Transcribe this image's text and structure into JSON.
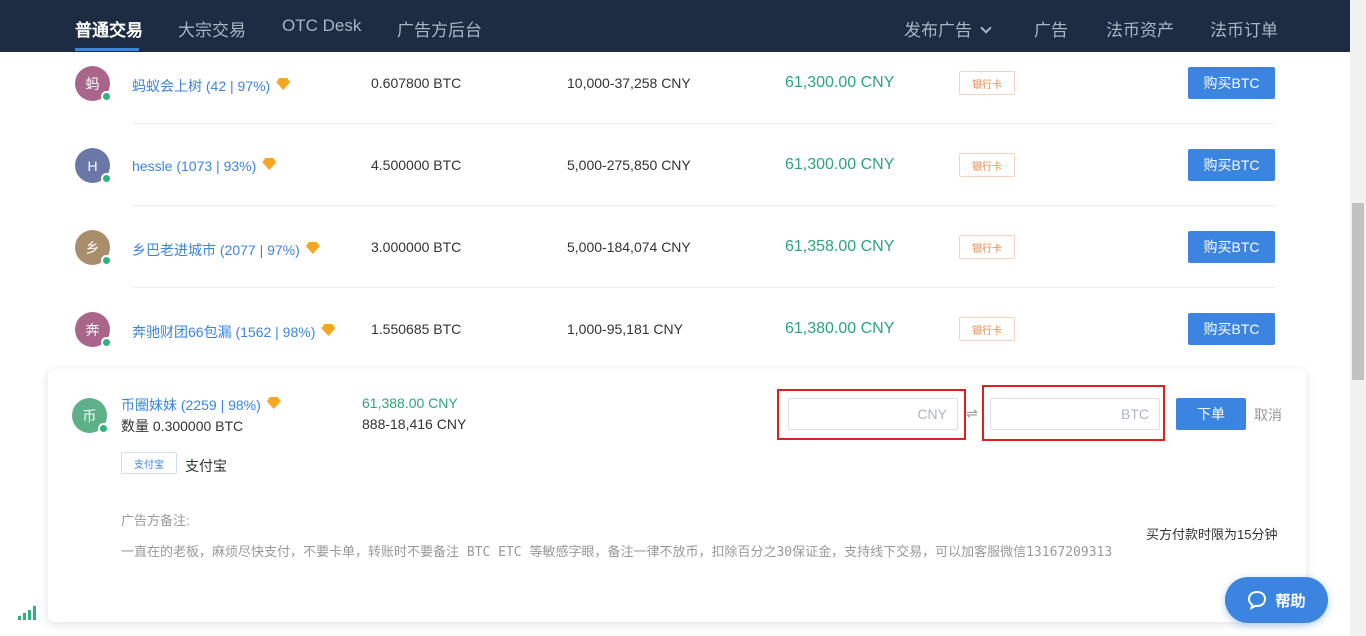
{
  "header": {
    "nav_left": [
      "普通交易",
      "大宗交易",
      "OTC Desk",
      "广告方后台"
    ],
    "publish_label": "发布广告",
    "nav_right": [
      "广告",
      "法币资产",
      "法币订单"
    ]
  },
  "listings": [
    {
      "avatar": "蚂",
      "avatar_color": "#a9668a",
      "seller": "蚂蚁会上树 (42 | 97%)",
      "amount": "0.607800 BTC",
      "limit": "10,000-37,258 CNY",
      "price": "61,300.00 CNY",
      "payment": "银行卡",
      "buy_label": "购买BTC"
    },
    {
      "avatar": "H",
      "avatar_color": "#6a78a8",
      "seller": "hessle (1073 | 93%)",
      "amount": "4.500000 BTC",
      "limit": "5,000-275,850 CNY",
      "price": "61,300.00 CNY",
      "payment": "银行卡",
      "buy_label": "购买BTC"
    },
    {
      "avatar": "乡",
      "avatar_color": "#a88e6a",
      "seller": "乡巴老进城市 (2077 | 97%)",
      "amount": "3.000000 BTC",
      "limit": "5,000-184,074 CNY",
      "price": "61,358.00 CNY",
      "payment": "银行卡",
      "buy_label": "购买BTC"
    },
    {
      "avatar": "奔",
      "avatar_color": "#a9668a",
      "seller": "奔驰财团66包漏 (1562 | 98%)",
      "amount": "1.550685 BTC",
      "limit": "1,000-95,181 CNY",
      "price": "61,380.00 CNY",
      "payment": "银行卡",
      "buy_label": "购买BTC"
    }
  ],
  "expanded": {
    "avatar": "币",
    "seller": "币圈妹妹 (2259 | 98%)",
    "quantity": "数量 0.300000 BTC",
    "price": "61,388.00 CNY",
    "limit": "888-18,416 CNY",
    "payment_badge": "支付宝",
    "payment_label": "支付宝",
    "cny_placeholder": "CNY",
    "btc_placeholder": "BTC",
    "swap_symbol": "⇌",
    "order_label": "下单",
    "cancel_label": "取消",
    "remark_label": "广告方备注:",
    "remark": "一直在的老板，麻烦尽快支付，不要卡单，转账时不要备注 BTC   ETC 等敏感字眼，备注一律不放币，扣除百分之30保证金，支持线下交易，可以加客服微信13167209313",
    "time_limit": "买方付款时限为15分钟"
  },
  "help_label": "帮助",
  "colors": {
    "accent": "#3b85e0",
    "price_green": "#2aa57a",
    "header_bg": "#1d2b43",
    "highlight_red": "#e02020"
  }
}
